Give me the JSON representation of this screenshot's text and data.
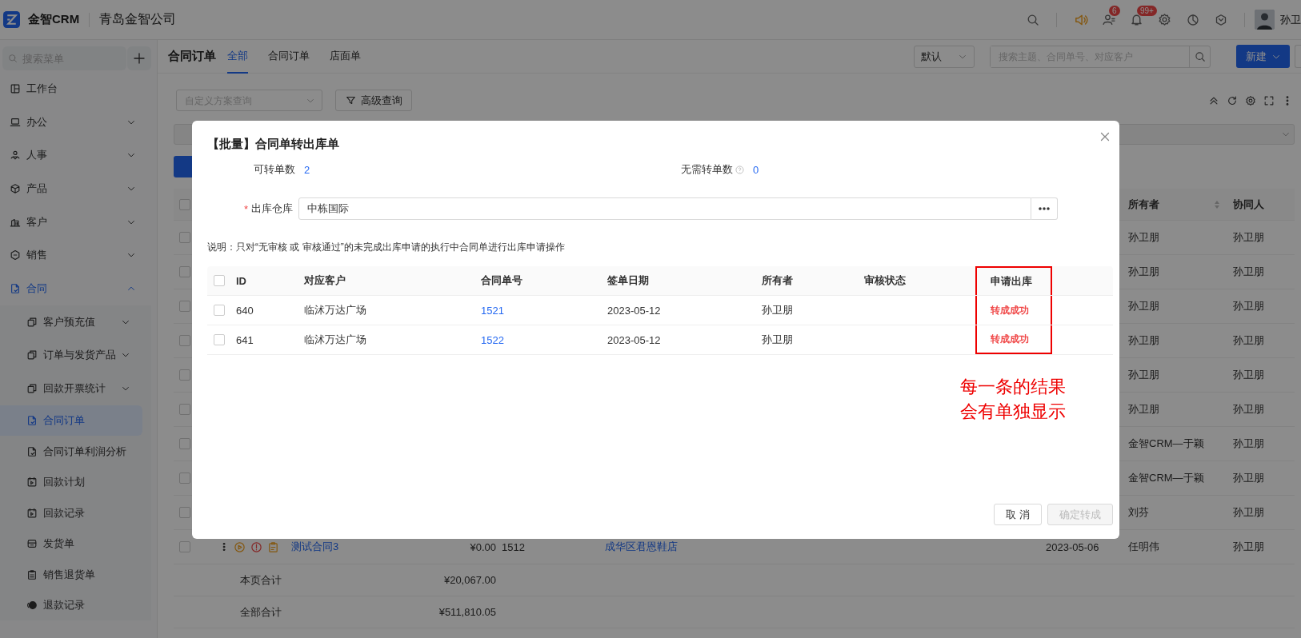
{
  "header": {
    "logo_text": "金智CRM",
    "company": "青岛金智公司",
    "contacts_badge": "6",
    "notifications_badge": "99+",
    "user_name": "孙卫"
  },
  "sidebar": {
    "search_placeholder": "搜索菜单",
    "items": [
      {
        "label": "工作台",
        "selected": false
      },
      {
        "label": "办公",
        "selected": false,
        "expanded": false
      },
      {
        "label": "人事",
        "selected": false,
        "expanded": false
      },
      {
        "label": "产品",
        "selected": false,
        "expanded": false
      },
      {
        "label": "客户",
        "selected": false,
        "expanded": false
      },
      {
        "label": "销售",
        "selected": false,
        "expanded": false
      },
      {
        "label": "合同",
        "selected": false,
        "expanded": true,
        "children": [
          {
            "label": "客户预充值",
            "selected": false,
            "expanded": false
          },
          {
            "label": "订单与发货产品",
            "selected": false,
            "expanded": false
          },
          {
            "label": "回款开票统计",
            "selected": false,
            "expanded": false
          },
          {
            "label": "合同订单",
            "selected": true
          },
          {
            "label": "合同订单利润分析",
            "selected": false
          },
          {
            "label": "回款计划",
            "selected": false
          },
          {
            "label": "回款记录",
            "selected": false
          },
          {
            "label": "发货单",
            "selected": false
          },
          {
            "label": "销售退货单",
            "selected": false
          },
          {
            "label": "退款记录",
            "selected": false
          }
        ]
      }
    ]
  },
  "main": {
    "title": "合同订单",
    "tabs": [
      {
        "label": "全部",
        "selected": true
      },
      {
        "label": "合同订单",
        "selected": false
      },
      {
        "label": "店面单",
        "selected": false
      }
    ],
    "view_select": "默认",
    "search_placeholder": "搜索主题、合同单号、对应客户",
    "new_button": "新建",
    "scheme_placeholder": "自定义方案查询",
    "advanced_button": "高级查询"
  },
  "table": {
    "header_checked": false,
    "columns": [
      {
        "label": "所有者",
        "sortable": true
      },
      {
        "label": "协同人",
        "sortable": false
      }
    ],
    "rows": [
      {
        "checked": false,
        "owner": "孙卫朋",
        "collaborator": "孙卫朋"
      },
      {
        "checked": false,
        "owner": "孙卫朋",
        "collaborator": "孙卫朋"
      },
      {
        "checked": false,
        "owner": "孙卫朋",
        "collaborator": "孙卫朋"
      },
      {
        "checked": false,
        "owner": "孙卫朋",
        "collaborator": "孙卫朋"
      },
      {
        "checked": false,
        "owner": "孙卫朋",
        "collaborator": "孙卫朋"
      },
      {
        "checked": false,
        "owner": "孙卫朋",
        "collaborator": "孙卫朋"
      },
      {
        "checked": false,
        "owner": "金智CRM—于颖",
        "collaborator": "孙卫朋"
      },
      {
        "checked": false,
        "owner": "金智CRM—于颖",
        "collaborator": "孙卫朋"
      },
      {
        "checked": false,
        "owner": "刘芬",
        "collaborator": "孙卫朋"
      },
      {
        "checked": false,
        "name": "测试合同3",
        "amount": "¥0.00",
        "number": "1512",
        "customer": "成华区君恩鞋店",
        "date": "2023-05-06",
        "owner": "任明伟",
        "collaborator": "孙卫朋"
      }
    ],
    "totals": [
      {
        "label": "本页合计",
        "amount": "¥20,067.00"
      },
      {
        "label": "全部合计",
        "amount": "¥511,810.05"
      }
    ]
  },
  "dialog": {
    "title": "【批量】合同单转出库单",
    "stats": [
      {
        "label": "可转单数",
        "value": "2",
        "help": false
      },
      {
        "label": "无需转单数",
        "value": "0",
        "help": true
      }
    ],
    "warehouse": {
      "required_mark": "*",
      "label": "出库仓库",
      "value": "中栋国际"
    },
    "note": "说明：只对“无审核 或 审核通过”的未完成出库申请的执行中合同单进行出库申请操作",
    "header_checked": false,
    "columns": [
      {
        "label": "ID",
        "highlighted": false
      },
      {
        "label": "对应客户",
        "highlighted": false
      },
      {
        "label": "合同单号",
        "highlighted": false
      },
      {
        "label": "签单日期",
        "highlighted": false
      },
      {
        "label": "所有者",
        "highlighted": false
      },
      {
        "label": "审核状态",
        "highlighted": false
      },
      {
        "label": "申请出库",
        "highlighted": true
      }
    ],
    "rows": [
      {
        "checked": false,
        "id": "640",
        "customer": "临沭万达广场",
        "number": "1521",
        "date": "2023-05-12",
        "owner": "孙卫朋",
        "result": "转成成功"
      },
      {
        "checked": false,
        "id": "641",
        "customer": "临沭万达广场",
        "number": "1522",
        "date": "2023-05-12",
        "owner": "孙卫朋",
        "result": "转成成功"
      }
    ],
    "buttons": [
      {
        "label": "取 消",
        "disabled": false
      },
      {
        "label": "确定转成",
        "disabled": true
      }
    ]
  },
  "annotation": {
    "lines": [
      "每一条的结果",
      "会有单独显示"
    ]
  }
}
